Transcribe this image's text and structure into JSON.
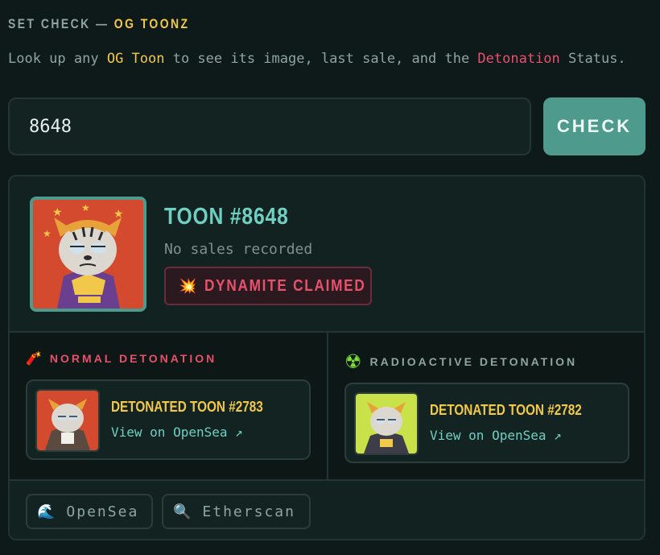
{
  "header": {
    "title_prefix": "SET CHECK — ",
    "title_accent": "OG TOONZ"
  },
  "description": {
    "part1": "Look up any ",
    "highlight1": "OG Toon",
    "part2": " to see its image, last sale, and the ",
    "highlight2": "Detonation",
    "part3": " Status."
  },
  "search": {
    "value": "8648",
    "button_label": "CHECK"
  },
  "result": {
    "title": "TOON #8648",
    "sales_text": "No sales recorded",
    "status_icon": "💥",
    "status_label": "DYNAMITE CLAIMED"
  },
  "normal_detonation": {
    "icon": "🧨",
    "heading": "NORMAL DETONATION",
    "toon_title": "DETONATED TOON #2783",
    "link_label": "View on OpenSea ↗"
  },
  "radioactive_detonation": {
    "icon": "☢",
    "heading": "RADIOACTIVE DETONATION",
    "toon_title": "DETONATED TOON #2782",
    "link_label": "View on OpenSea ↗"
  },
  "footer": {
    "opensea_icon": "🌊",
    "opensea_label": "OpenSea",
    "etherscan_icon": "🔍",
    "etherscan_label": "Etherscan"
  },
  "colors": {
    "background": "#0e1919",
    "accent_teal": "#4e9a8d",
    "accent_yellow": "#f2c84b",
    "accent_pink": "#e8516b"
  }
}
